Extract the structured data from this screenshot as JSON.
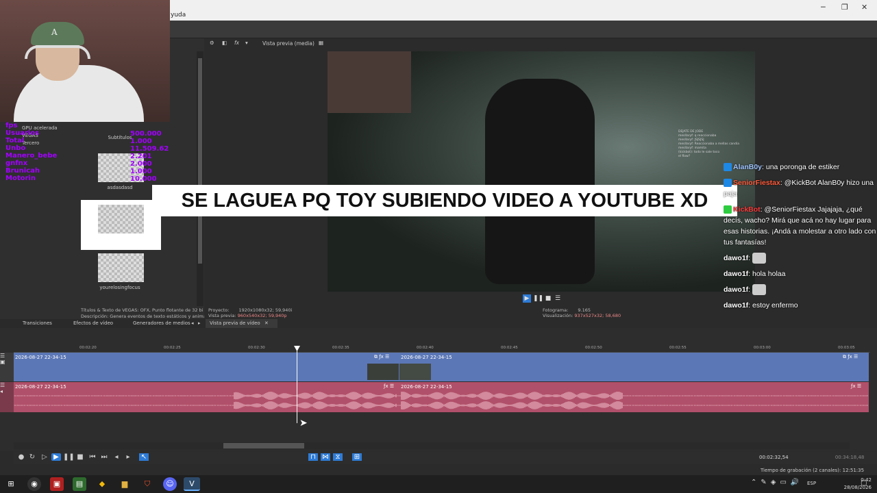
{
  "window": {
    "menu_fragment": "yuda",
    "controls": {
      "minimize": "─",
      "restore": "❐",
      "close": "✕"
    }
  },
  "media_panel": {
    "tree": [
      "GPU acelerada",
      "VEGAS",
      "Tercero"
    ],
    "items": [
      {
        "label": "Subtítulos"
      },
      {
        "label": "asdasdasd"
      },
      {
        "label": ""
      },
      {
        "label": "yourelosingfocus"
      }
    ],
    "description_line1": "Títulos & Texto de VEGAS: OFX, Punto flotante de 32 bi",
    "description_line2": "Descripción: Genera eventos de texto estáticos y anima",
    "tabs": [
      "Transiciones",
      "Efectos de vídeo",
      "Generadores de medios"
    ]
  },
  "preview": {
    "mode_label": "Vista previa (media)",
    "tab_label": "Vista previa de vídeo",
    "project_label": "Proyecto:",
    "project_value": "1920x1080x32; 59,940i",
    "preview_label": "Vista previa:",
    "preview_value": "960x540x32; 59,940p",
    "frame_label": "Fotograma:",
    "frame_value": "9.165",
    "display_label": "Visualización:",
    "display_value": "937x527x32; 58,680",
    "chat_small": [
      "DEJATE DE JODE",
      "mesllaryf: q reaccionaba",
      "mesllaryf: JSJSJSJ",
      "mesllaryf: Reaccionaba a mellas candia",
      "mesllaryf: mamita",
      "(kickbot): todo le sale toco",
      "el flow?"
    ]
  },
  "overlay": {
    "webcam_cap_letter": "A",
    "stats_lines": [
      "fps",
      "Usuarios",
      "Total",
      "Unbo",
      "Manero_bebe",
      "gnfnx",
      "Brunicah",
      "Motorin"
    ],
    "stats_values": [
      "500.000",
      "1.000",
      "11.509.62",
      "2.201",
      "2.000",
      "1.000",
      "10.000"
    ],
    "banner": "SE LAGUEA PQ TOY SUBIENDO VIDEO A YOUTUBE XD"
  },
  "chat": [
    {
      "user": "AlanB0y",
      "color": "#9ec3ff",
      "badge": "#1e88e5",
      "text": ": una poronga de estiker"
    },
    {
      "user": "SeniorFiestax",
      "color": "#ff5a3a",
      "badge": "#1e88e5",
      "text": ": @KickBot AlanB0y hizo una paja"
    },
    {
      "user": "KickBot",
      "color": "#ff3b3b",
      "badge": "#2ecc40",
      "text": ": @SeniorFiestax Jajajaja, ¿qué decís, wacho? Mirá que acá no hay lugar para esas historias. ¡Andá a molestar a otro lado con tus fantasías!"
    },
    {
      "user": "dawo1f",
      "color": "#ffffff",
      "badge": "",
      "text": ": ",
      "emote": true
    },
    {
      "user": "dawo1f",
      "color": "#ffffff",
      "badge": "",
      "text": ": hola holaa"
    },
    {
      "user": "dawo1f",
      "color": "#ffffff",
      "badge": "",
      "text": ": ",
      "emote": true
    },
    {
      "user": "dawo1f",
      "color": "#ffffff",
      "badge": "",
      "text": ": estoy enfermo"
    }
  ],
  "timeline": {
    "ruler_ticks": [
      "00:02:20",
      "00:02:25",
      "00:02:30",
      "00:02:35",
      "00:02:40",
      "00:02:45",
      "00:02:50",
      "00:02:55",
      "00:03:00",
      "00:03:05"
    ],
    "video_clip_1": "2026-08-27 22-34-15",
    "video_clip_2": "2026-08-27 22-34-15",
    "audio_clip_1": "2026-08-27 22-34-15",
    "audio_clip_2": "2026-08-27 22-34-15",
    "cursor_time": "00:02:32,54",
    "end_time": "00:34:18,48",
    "record_time_label": "Tiempo de grabación (2 canales): 12:51:35"
  },
  "taskbar": {
    "language": "ESP",
    "time": "0:42",
    "date": "28/08/2026"
  },
  "colors": {
    "video_track": "#5b77b6",
    "audio_track": "#b1506a",
    "accent": "#2e7bd6",
    "stats_purple": "#a200ff"
  }
}
